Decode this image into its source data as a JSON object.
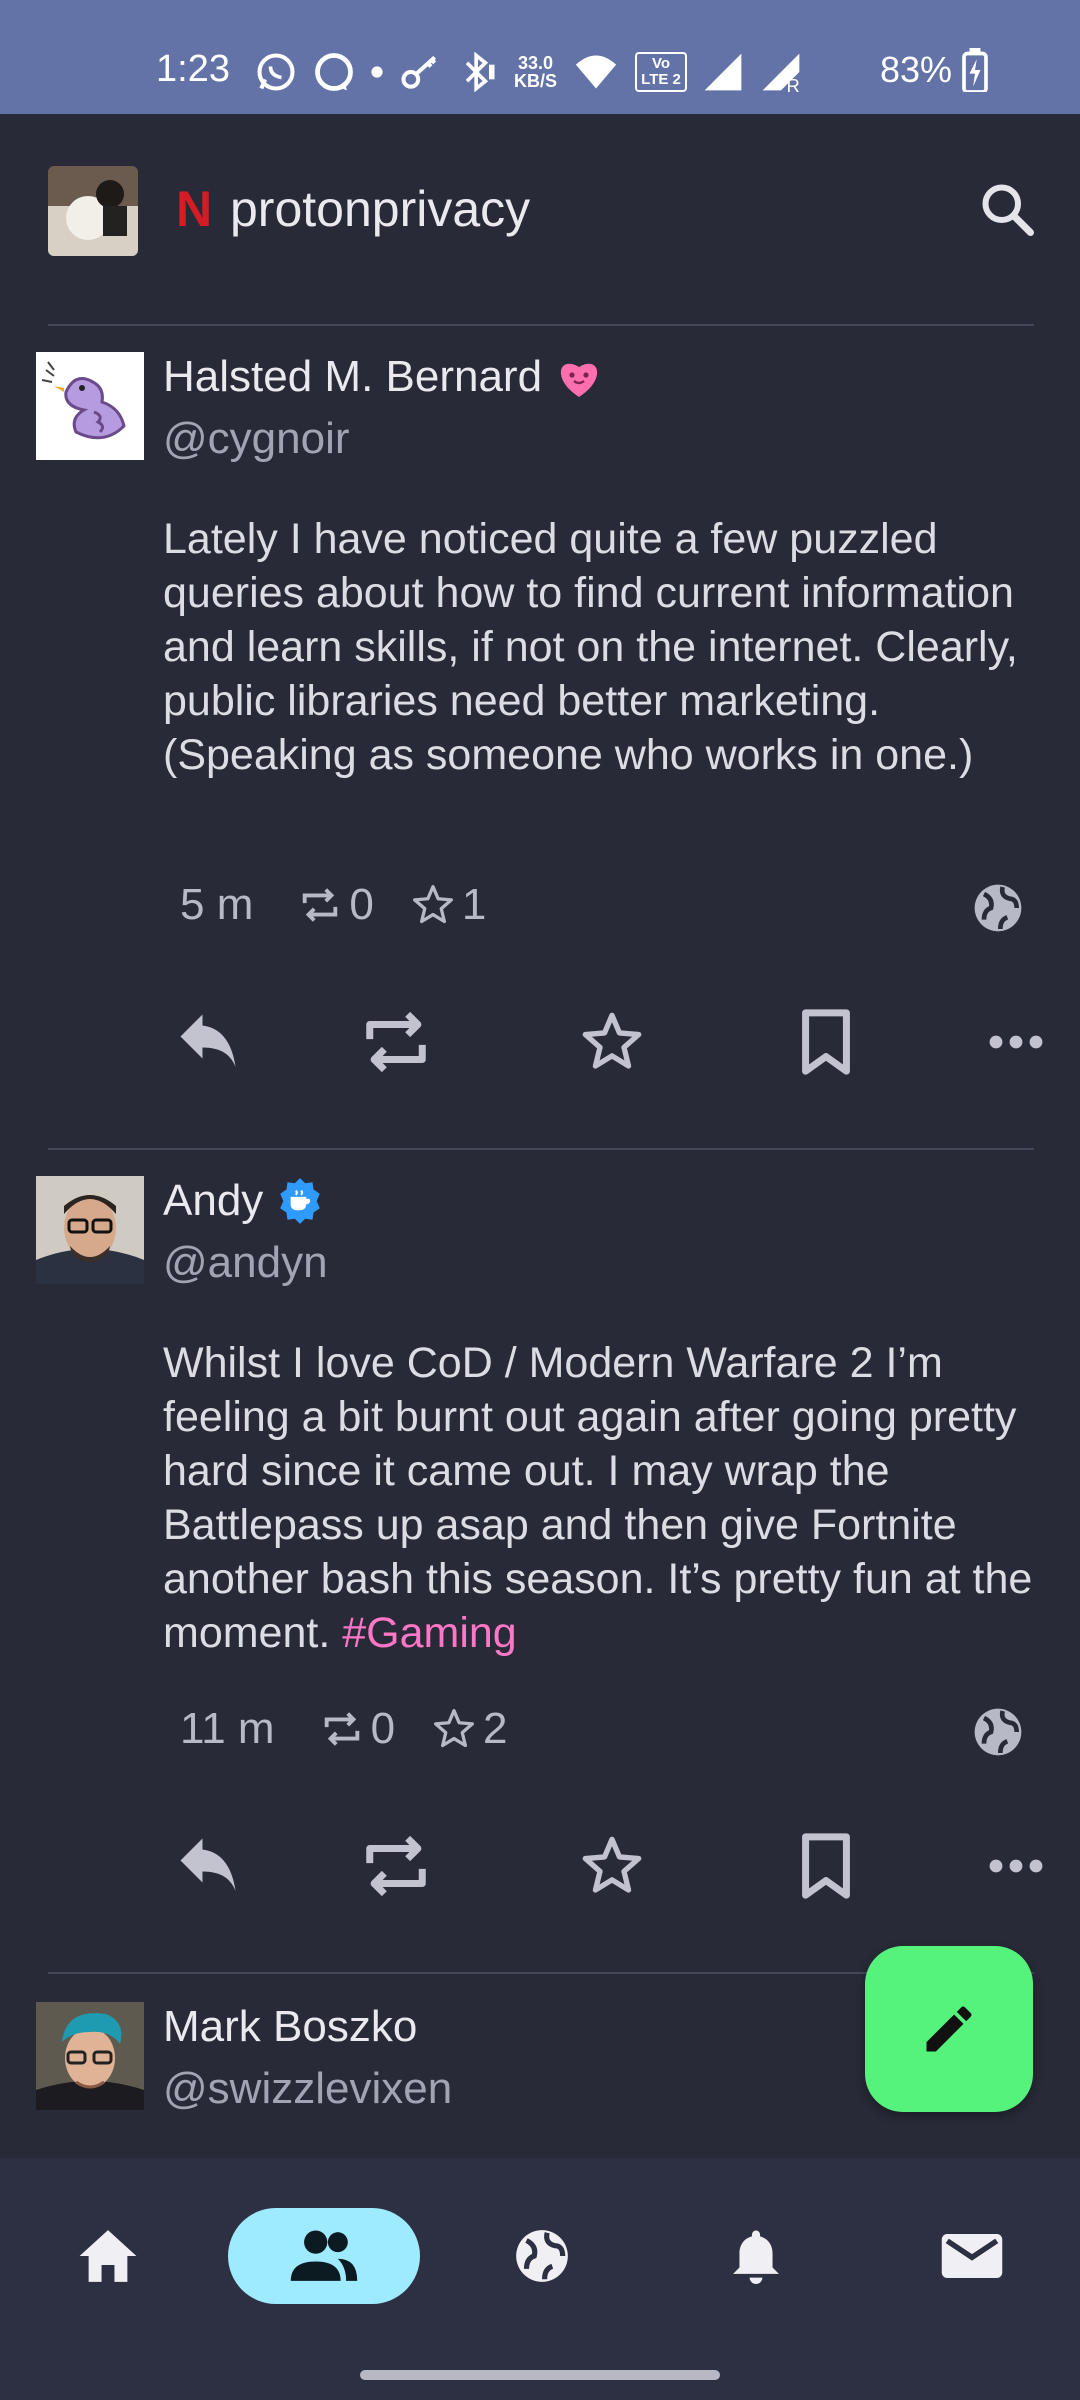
{
  "status_bar": {
    "time": "1:23",
    "speed_value": "33.0",
    "speed_unit": "KB/S",
    "volte": "Vo LTE 2",
    "roaming": "R",
    "battery": "83%"
  },
  "header": {
    "brand_letter": "N",
    "account_name": "protonprivacy"
  },
  "posts": [
    {
      "display_name": "Halsted M. Bernard",
      "handle": "@cygnoir",
      "content": "Lately I have noticed quite a few puzzled queries about how to find current information and learn skills, if not on the internet. Clearly, public libraries need better marketing. (Speaking as someone who works in one.)",
      "hashtag": "",
      "time": "5 m",
      "boosts": "0",
      "favourites": "1"
    },
    {
      "display_name": "Andy",
      "handle": "@andyn",
      "content": "Whilst I love CoD / Modern Warfare 2 I’m feeling a bit burnt out again after going pretty hard since it came out. I may wrap the Battlepass up asap and then give Fortnite another bash this season. It’s pretty fun at the moment. ",
      "hashtag": "#Gaming",
      "time": "11 m",
      "boosts": "0",
      "favourites": "2"
    },
    {
      "display_name": "Mark Boszko",
      "handle": "@swizzlevixen"
    }
  ],
  "icons": {
    "search": "search-icon",
    "reply": "reply-icon",
    "boost": "boost-icon",
    "favourite": "star-icon",
    "bookmark": "bookmark-icon",
    "more": "more-icon",
    "visibility": "globe-icon",
    "compose": "pencil-icon",
    "nav": [
      "home-icon",
      "people-icon",
      "globe-icon",
      "bell-icon",
      "mail-icon"
    ]
  },
  "colors": {
    "status_bar": "#6373a8",
    "background": "#282a37",
    "hashtag": "#ff77c6",
    "fab": "#55f27c",
    "nav_active": "#9eeaff",
    "verified_badge": "#2f9bff"
  }
}
